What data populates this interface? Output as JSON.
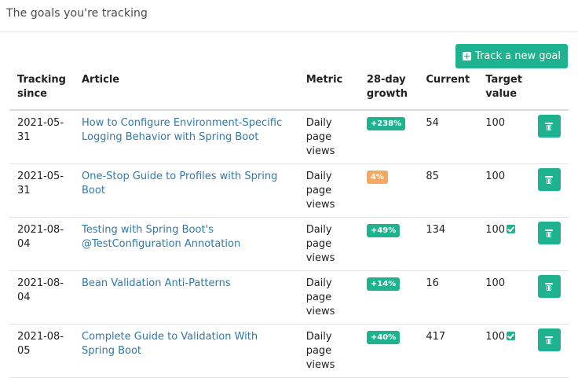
{
  "header": {
    "title": "The goals you're tracking"
  },
  "toolbar": {
    "track_label": "Track a new goal",
    "track_icon": "plus-square-icon"
  },
  "table": {
    "columns": {
      "since": "Tracking since",
      "article": "Article",
      "metric": "Metric",
      "growth": "28-day growth",
      "current": "Current",
      "target": "Target value"
    },
    "rows": [
      {
        "since": "2021-05-31",
        "article": "How to Configure Environment-Specific Logging Behavior with Spring Boot",
        "metric": "Daily page views",
        "growth": "+238%",
        "growth_color": "#1fb28e",
        "current": "54",
        "target": "100",
        "target_reached": false
      },
      {
        "since": "2021-05-31",
        "article": "One-Stop Guide to Profiles with Spring Boot",
        "metric": "Daily page views",
        "growth": "4%",
        "growth_color": "#f4a860",
        "current": "85",
        "target": "100",
        "target_reached": false
      },
      {
        "since": "2021-08-04",
        "article": "Testing with Spring Boot's @TestConfiguration Annotation",
        "metric": "Daily page views",
        "growth": "+49%",
        "growth_color": "#1fb28e",
        "current": "134",
        "target": "100",
        "target_reached": true
      },
      {
        "since": "2021-08-04",
        "article": "Bean Validation Anti-Patterns",
        "metric": "Daily page views",
        "growth": "+14%",
        "growth_color": "#1fb28e",
        "current": "16",
        "target": "100",
        "target_reached": false
      },
      {
        "since": "2021-08-05",
        "article": "Complete Guide to Validation With Spring Boot",
        "metric": "Daily page views",
        "growth": "+40%",
        "growth_color": "#1fb28e",
        "current": "417",
        "target": "100",
        "target_reached": true
      }
    ]
  },
  "colors": {
    "accent": "#1fb28e",
    "link": "#2e7aab",
    "warning": "#f4a860"
  }
}
